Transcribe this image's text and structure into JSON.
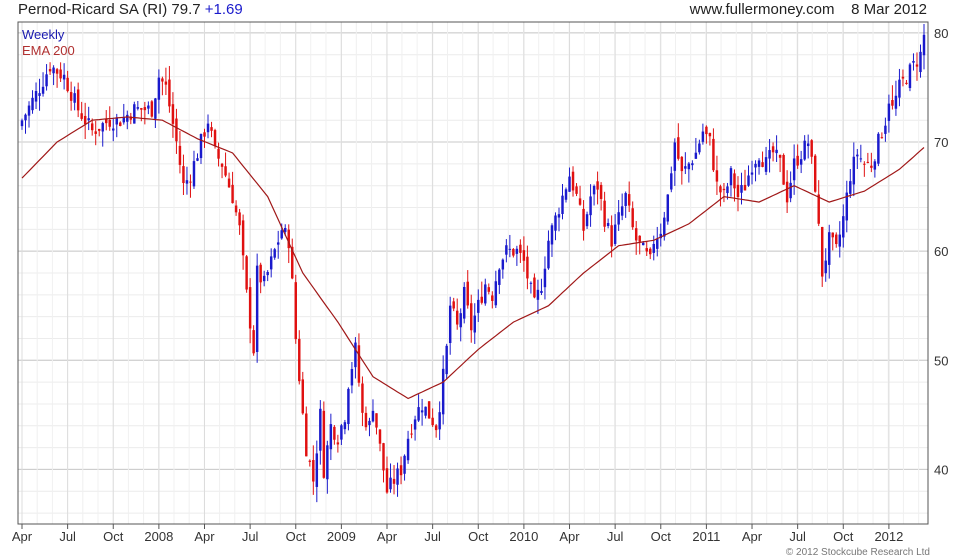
{
  "header": {
    "symbol": "Pernod-Ricard SA (RI)",
    "last": "79.7",
    "change": "+1.69",
    "site": "www.fullermoney.com",
    "date": "8 Mar 2012"
  },
  "legend": {
    "weekly": "Weekly",
    "ema": "EMA 200"
  },
  "copyright": "© 2012 Stockcube Research Ltd",
  "colors": {
    "up": "#1a1acc",
    "down": "#e01010",
    "ema": "#a01818",
    "grid": "#d8d8d8",
    "frame": "#555555"
  },
  "chart_data": {
    "type": "candlestick",
    "ylim": [
      35,
      81
    ],
    "yticks": [
      40,
      50,
      60,
      70,
      80
    ],
    "x_tick_labels": [
      "Apr",
      "Jul",
      "Oct",
      "2008",
      "Apr",
      "Jul",
      "Oct",
      "2009",
      "Apr",
      "Jul",
      "Oct",
      "2010",
      "Apr",
      "Jul",
      "Oct",
      "2011",
      "Apr",
      "Jul",
      "Oct",
      "2012"
    ],
    "x_tick_weeks": [
      0,
      13,
      26,
      39,
      52,
      65,
      78,
      91,
      104,
      117,
      130,
      143,
      156,
      169,
      182,
      195,
      208,
      221,
      234,
      247
    ],
    "total_weeks": 258,
    "series": [
      {
        "name": "Weekly",
        "type": "candlestick",
        "anchor_weeks": [
          0,
          5,
          8,
          12,
          16,
          20,
          25,
          28,
          32,
          37,
          39,
          41,
          44,
          46,
          48,
          50,
          52,
          53,
          55,
          57,
          60,
          62,
          64,
          66,
          67,
          69,
          72,
          74,
          76,
          77,
          78,
          80,
          81,
          83,
          84,
          85,
          86,
          88,
          90,
          92,
          93,
          95,
          97,
          99,
          100,
          102,
          103,
          104,
          106,
          108,
          110,
          112,
          114,
          116,
          118,
          119,
          121,
          122,
          124,
          126,
          128,
          130,
          132,
          134,
          136,
          138,
          140,
          141,
          143,
          146,
          148,
          150,
          152,
          155,
          156,
          158,
          160,
          162,
          164,
          166,
          168,
          170,
          172,
          174,
          175,
          177,
          179,
          180,
          182,
          184,
          186,
          188,
          190,
          192,
          194,
          196,
          198,
          200,
          202,
          204,
          206,
          208,
          210,
          212,
          214,
          216,
          218,
          220,
          222,
          224,
          226,
          228,
          230,
          232,
          234,
          236,
          238,
          240,
          242,
          244,
          246,
          247,
          248,
          250,
          252,
          254,
          256,
          257
        ],
        "anchor_close": [
          72,
          75,
          77,
          76,
          73,
          71,
          72,
          72,
          73,
          73,
          76,
          75,
          70,
          66,
          67,
          69,
          71,
          72,
          69,
          68,
          65,
          62,
          56,
          51,
          58,
          57,
          60,
          62,
          61,
          57,
          52,
          45,
          42,
          39,
          42,
          45,
          40,
          44,
          43,
          45,
          48,
          51,
          45,
          44,
          46,
          42,
          40,
          38,
          39,
          40,
          43,
          45,
          46,
          45,
          44,
          46,
          51,
          55,
          53,
          56,
          53,
          55,
          57,
          56,
          59,
          60,
          60,
          60,
          59,
          55,
          57,
          61,
          63,
          66,
          67,
          65,
          62,
          65,
          66,
          63,
          61,
          63,
          65,
          62,
          61,
          60,
          59,
          61,
          62,
          65,
          70,
          67,
          68,
          69,
          71,
          70,
          66,
          65,
          67,
          65,
          66,
          68,
          69,
          68,
          69,
          68,
          65,
          68,
          69,
          70,
          66,
          58,
          61,
          60,
          63,
          67,
          69,
          68,
          68,
          70,
          72,
          74,
          73,
          75,
          76,
          77,
          78,
          79.7
        ]
      },
      {
        "name": "EMA 200",
        "type": "line",
        "anchor_weeks": [
          0,
          10,
          20,
          30,
          40,
          50,
          60,
          70,
          80,
          90,
          100,
          110,
          120,
          130,
          140,
          150,
          160,
          170,
          180,
          190,
          200,
          210,
          220,
          230,
          240,
          250,
          257
        ],
        "anchor_values": [
          66.7,
          70,
          72,
          72.3,
          72,
          70.3,
          69,
          65,
          58,
          53.5,
          48.5,
          46.5,
          48,
          51,
          53.5,
          55,
          58,
          60.5,
          61,
          62.5,
          65,
          64.5,
          66,
          64.5,
          65.5,
          67.5,
          69.5
        ]
      }
    ]
  }
}
